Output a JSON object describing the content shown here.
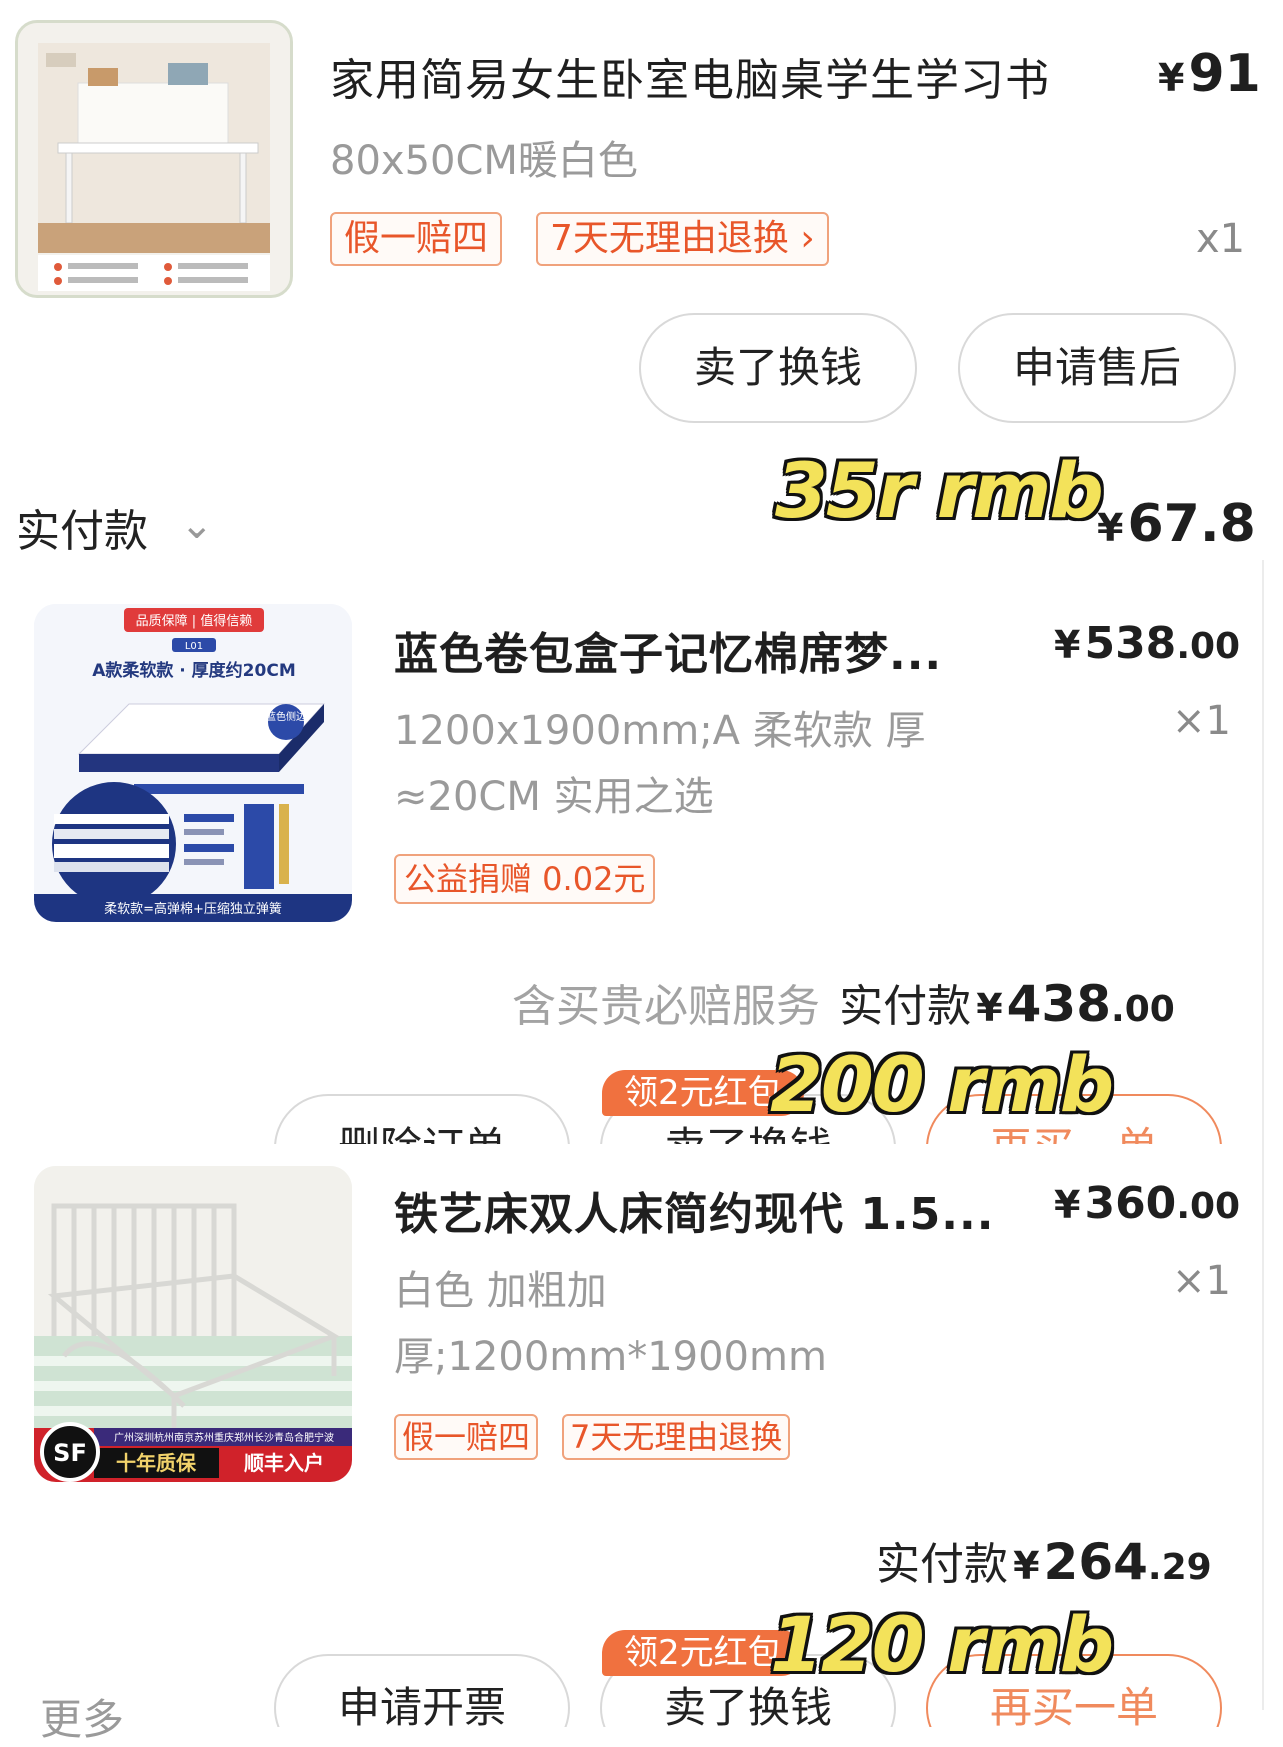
{
  "order1": {
    "title": "家用简易女生卧室电脑桌学生学习书",
    "spec": "80x50CM暖白色",
    "price_yen": "¥",
    "price": "91",
    "tags": [
      "假一赔四",
      "7天无理由退换 ›"
    ],
    "qty": "x1",
    "buttons": [
      "卖了换钱",
      "申请售后"
    ],
    "paid_label": "实付款",
    "paid_chevron": "⌄",
    "paid_yen": "¥",
    "paid_amount": "67.8",
    "annotation": "35r rmb"
  },
  "order2": {
    "title": "蓝色卷包盒子记忆棉席梦...",
    "spec_line1": "1200x1900mm;A 柔软款 厚",
    "spec_line2": "≈20CM 实用之选",
    "price_yen": "¥",
    "price_int": "538",
    "price_dec": ".00",
    "qty": "×1",
    "tag": "公益捐赠 0.02元",
    "service": "含买贵必赔服务",
    "paid_label": "实付款",
    "paid_yen": "¥",
    "paid_int": "438",
    "paid_dec": ".00",
    "coupon_pill": "领2元红包",
    "buttons": [
      "删除订单",
      "卖了换钱",
      "再买一单"
    ],
    "annotation": "200 rmb",
    "image_text": {
      "banner": "品质保障 | 值得信赖",
      "code": "L01",
      "heading": "A款柔软款 · 厚度约20CM",
      "badge": "蓝色侧边",
      "footer": "柔软款=高弹棉+压缩独立弹簧"
    }
  },
  "order3": {
    "title": "铁艺床双人床简约现代 1.5...",
    "spec_line1": "白色 加粗加",
    "spec_line2": "厚;1200mm*1900mm",
    "price_yen": "¥",
    "price_int": "360",
    "price_dec": ".00",
    "qty": "×1",
    "tags": [
      "假一赔四",
      "7天无理由退换"
    ],
    "paid_label": "实付款",
    "paid_yen": "¥",
    "paid_int": "264",
    "paid_dec": ".29",
    "coupon_pill": "领2元红包",
    "more": "更多",
    "buttons": [
      "申请开票",
      "卖了换钱",
      "再买一单"
    ],
    "annotation": "120 rmb",
    "image_text": {
      "cities": "广州深圳杭州南京苏州重庆郑州长沙青岛合肥宁波",
      "warranty": "十年质保",
      "shipping": "顺丰入户",
      "logo": "SF"
    }
  },
  "colors": {
    "accent": "#f0713f",
    "tag_border": "#f0a27c",
    "tag_text": "#e8562a",
    "annotation_fill": "#f3e25a"
  }
}
